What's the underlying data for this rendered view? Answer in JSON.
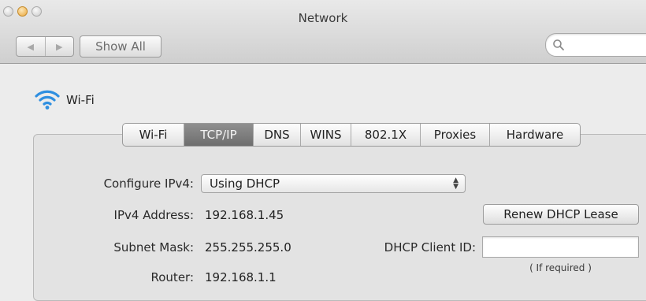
{
  "window": {
    "title": "Network"
  },
  "toolbar": {
    "show_all_label": "Show All",
    "search_placeholder": ""
  },
  "service": {
    "name": "Wi-Fi",
    "icon": "wifi-icon"
  },
  "tabs": [
    {
      "label": "Wi-Fi",
      "active": false
    },
    {
      "label": "TCP/IP",
      "active": true
    },
    {
      "label": "DNS",
      "active": false
    },
    {
      "label": "WINS",
      "active": false
    },
    {
      "label": "802.1X",
      "active": false
    },
    {
      "label": "Proxies",
      "active": false
    },
    {
      "label": "Hardware",
      "active": false
    }
  ],
  "tcpip": {
    "configure_ipv4_label": "Configure IPv4:",
    "configure_ipv4_value": "Using DHCP",
    "ipv4_address_label": "IPv4 Address:",
    "ipv4_address_value": "192.168.1.45",
    "subnet_mask_label": "Subnet Mask:",
    "subnet_mask_value": "255.255.255.0",
    "router_label": "Router:",
    "router_value": "192.168.1.1",
    "renew_button_label": "Renew DHCP Lease",
    "dhcp_client_id_label": "DHCP Client ID:",
    "dhcp_client_id_value": "",
    "if_required_note": "( If required )"
  },
  "colors": {
    "active_tab": "#7a7a7a",
    "window_bg": "#ececec",
    "wifi_blue": "#2f8fe0"
  }
}
